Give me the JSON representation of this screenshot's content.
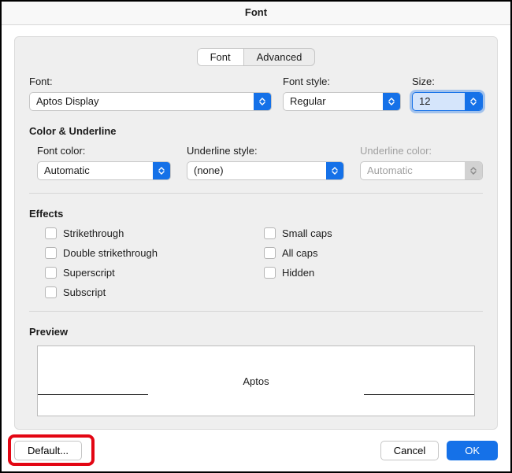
{
  "title": "Font",
  "tabs": {
    "font": "Font",
    "advanced": "Advanced"
  },
  "font_section": {
    "font_label": "Font:",
    "font_value": "Aptos Display",
    "style_label": "Font style:",
    "style_value": "Regular",
    "size_label": "Size:",
    "size_value": "12"
  },
  "color_underline": {
    "heading": "Color & Underline",
    "font_color_label": "Font color:",
    "font_color_value": "Automatic",
    "underline_style_label": "Underline style:",
    "underline_style_value": "(none)",
    "underline_color_label": "Underline color:",
    "underline_color_value": "Automatic"
  },
  "effects": {
    "heading": "Effects",
    "strikethrough": "Strikethrough",
    "double_strike": "Double strikethrough",
    "superscript": "Superscript",
    "subscript": "Subscript",
    "small_caps": "Small caps",
    "all_caps": "All caps",
    "hidden": "Hidden"
  },
  "preview": {
    "heading": "Preview",
    "text": "Aptos"
  },
  "buttons": {
    "default": "Default...",
    "cancel": "Cancel",
    "ok": "OK"
  }
}
